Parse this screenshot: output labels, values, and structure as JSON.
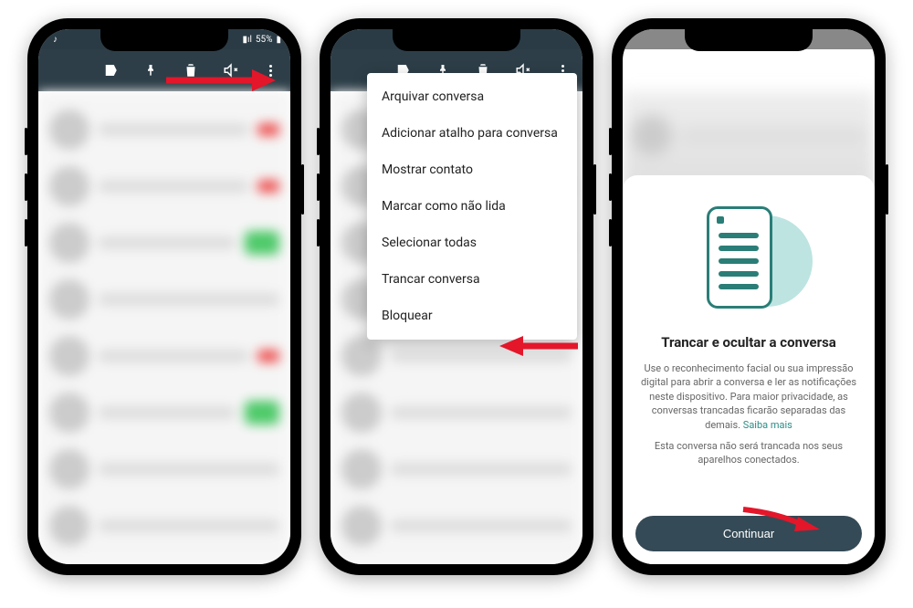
{
  "status": {
    "battery": "55%",
    "tiktok": "♪"
  },
  "menu": {
    "items": [
      "Arquivar conversa",
      "Adicionar atalho para conversa",
      "Mostrar contato",
      "Marcar como não lida",
      "Selecionar todas",
      "Trancar conversa",
      "Bloquear"
    ]
  },
  "modal": {
    "title": "Trancar e ocultar a conversa",
    "body1": "Use o reconhecimento facial ou sua impressão digital para abrir a conversa e ler as notificações neste dispositivo. Para maior privacidade, as conversas trancadas ficarão separadas das demais.",
    "link": "Saiba mais",
    "body2": "Esta conversa não será trancada nos seus aparelhos conectados.",
    "button": "Continuar"
  }
}
